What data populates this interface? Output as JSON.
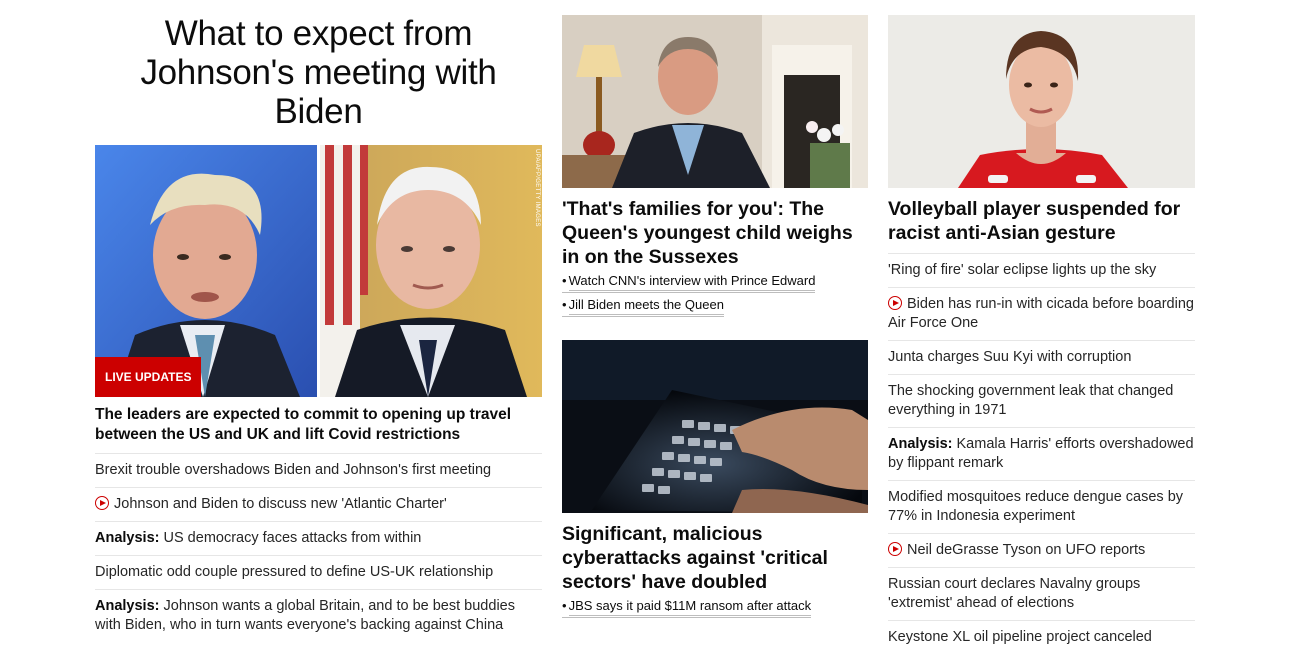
{
  "main": {
    "headline": "What to expect from Johnson's meeting with Biden",
    "badge": "LIVE UPDATES",
    "photo_credit": "UPA/AFP/GETTY IMAGES",
    "lead": "The leaders are expected to commit to opening up travel between the US and UK and lift Covid restrictions",
    "items": [
      {
        "prefix": "",
        "text": "Brexit trouble overshadows Biden and Johnson's first meeting",
        "video": false
      },
      {
        "prefix": "",
        "text": "Johnson and Biden to discuss new 'Atlantic Charter'",
        "video": true
      },
      {
        "prefix": "Analysis:",
        "text": " US democracy faces attacks from within",
        "video": false
      },
      {
        "prefix": "",
        "text": "Diplomatic odd couple pressured to define US-UK relationship",
        "video": false
      },
      {
        "prefix": "Analysis:",
        "text": " Johnson wants a global Britain, and to be best buddies with Biden, who in turn wants everyone's backing against China",
        "video": false
      }
    ]
  },
  "middle": {
    "card1": {
      "headline": "'That's families for you': The Queen's youngest child weighs in on the Sussexes",
      "related": [
        "Watch CNN's interview with Prince Edward",
        "Jill Biden meets the Queen"
      ]
    },
    "card2": {
      "headline": "Significant, malicious cyberattacks against 'critical sectors' have doubled",
      "related": [
        "JBS says it paid $11M ransom after attack"
      ]
    }
  },
  "right": {
    "headline": "Volleyball player suspended for racist anti-Asian gesture",
    "items": [
      {
        "prefix": "",
        "text": "'Ring of fire' solar eclipse lights up the sky",
        "video": false
      },
      {
        "prefix": "",
        "text": "Biden has run-in with cicada before boarding Air Force One",
        "video": true
      },
      {
        "prefix": "",
        "text": "Junta charges Suu Kyi with corruption",
        "video": false
      },
      {
        "prefix": "",
        "text": "The shocking government leak that changed everything in 1971",
        "video": false
      },
      {
        "prefix": "Analysis:",
        "text": " Kamala Harris' efforts overshadowed by flippant remark",
        "video": false
      },
      {
        "prefix": "",
        "text": "Modified mosquitoes reduce dengue cases by 77% in Indonesia experiment",
        "video": false
      },
      {
        "prefix": "",
        "text": "Neil deGrasse Tyson on UFO reports",
        "video": true
      },
      {
        "prefix": "",
        "text": "Russian court declares Navalny groups 'extremist' ahead of elections",
        "video": false
      },
      {
        "prefix": "",
        "text": "Keystone XL oil pipeline project canceled",
        "video": false
      }
    ]
  },
  "colors": {
    "accent": "#cc0000",
    "text": "#0c0c0c",
    "divider": "#e6e6e6"
  }
}
